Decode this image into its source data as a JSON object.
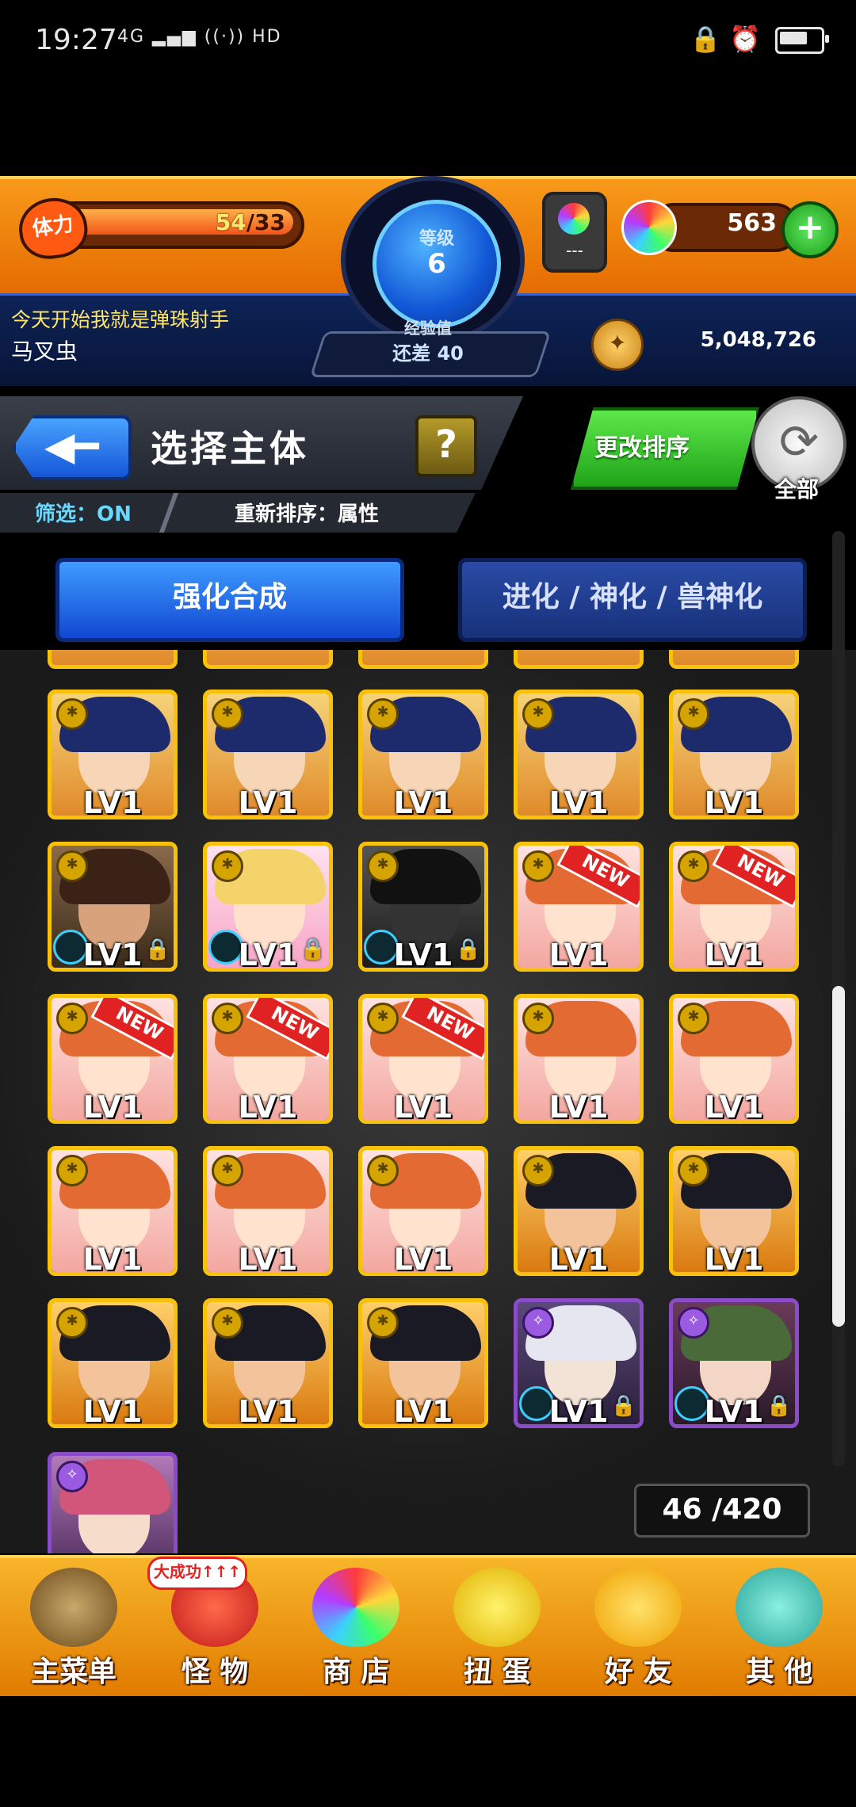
{
  "status_bar": {
    "time": "19:27",
    "signal": "4G",
    "hd": "HD"
  },
  "hud": {
    "stamina": {
      "label": "体力",
      "current": "54",
      "max": "/33"
    },
    "player_title": "今天开始我就是弹珠射手",
    "player_name": "马叉虫",
    "level": {
      "label": "等级",
      "value": "6"
    },
    "exp": {
      "label": "经验值",
      "value": "还差 40"
    },
    "gacha_text": "---",
    "orbs": "563",
    "coins": "5,048,726"
  },
  "title_bar": {
    "title": "选择主体",
    "help": "?",
    "filter": "筛选：ON",
    "sort": "重新排序：属性",
    "change_sort": "更改排序",
    "all": "全部"
  },
  "tabs": {
    "enhance": "强化合成",
    "evolve": "进化 / 神化 / 兽神化"
  },
  "monsters": [
    {
      "level": "LV1",
      "kind": "samurai",
      "new": "",
      "locked": false
    },
    {
      "level": "LV1",
      "kind": "samurai",
      "new": "",
      "locked": false
    },
    {
      "level": "LV1",
      "kind": "samurai",
      "new": "",
      "locked": false
    },
    {
      "level": "LV1",
      "kind": "samurai",
      "new": "",
      "locked": false
    },
    {
      "level": "LV1",
      "kind": "samurai",
      "new": "",
      "locked": false
    },
    {
      "level": "LV1",
      "kind": "warrior",
      "new": "",
      "locked": true
    },
    {
      "level": "LV1",
      "kind": "blonde",
      "new": "",
      "locked": true
    },
    {
      "level": "LV1",
      "kind": "knight",
      "new": "",
      "locked": true
    },
    {
      "level": "LV1",
      "kind": "sheep",
      "new": "NEW",
      "locked": false
    },
    {
      "level": "LV1",
      "kind": "sheep",
      "new": "NEW",
      "locked": false
    },
    {
      "level": "LV1",
      "kind": "sheep",
      "new": "NEW",
      "locked": false
    },
    {
      "level": "LV1",
      "kind": "sheep",
      "new": "NEW",
      "locked": false
    },
    {
      "level": "LV1",
      "kind": "sheep",
      "new": "NEW",
      "locked": false
    },
    {
      "level": "LV1",
      "kind": "sheep",
      "new": "",
      "locked": false
    },
    {
      "level": "LV1",
      "kind": "sheep",
      "new": "",
      "locked": false
    },
    {
      "level": "LV1",
      "kind": "sheep",
      "new": "",
      "locked": false
    },
    {
      "level": "LV1",
      "kind": "sheep",
      "new": "",
      "locked": false
    },
    {
      "level": "LV1",
      "kind": "sheep",
      "new": "",
      "locked": false
    },
    {
      "level": "LV1",
      "kind": "boy",
      "new": "",
      "locked": false
    },
    {
      "level": "LV1",
      "kind": "boy",
      "new": "",
      "locked": false
    },
    {
      "level": "LV1",
      "kind": "boy",
      "new": "",
      "locked": false
    },
    {
      "level": "LV1",
      "kind": "boy",
      "new": "",
      "locked": false
    },
    {
      "level": "LV1",
      "kind": "boy",
      "new": "",
      "locked": false
    },
    {
      "level": "LV1",
      "kind": "hooded",
      "new": "",
      "locked": true
    },
    {
      "level": "LV1",
      "kind": "witch",
      "new": "",
      "locked": true
    },
    {
      "level": "",
      "kind": "pink",
      "new": "",
      "locked": false
    }
  ],
  "monster_count": "46 /420",
  "bottom_nav": [
    {
      "label": "主菜单",
      "icon": "castle-icon"
    },
    {
      "label": "怪 物",
      "icon": "monster-icon",
      "badge": "大成功↑↑↑"
    },
    {
      "label": "商 店",
      "icon": "rainbow-orb-icon"
    },
    {
      "label": "扭 蛋",
      "icon": "egg-icon"
    },
    {
      "label": "好 友",
      "icon": "friends-icon"
    },
    {
      "label": "其 他",
      "icon": "question-icon"
    }
  ]
}
